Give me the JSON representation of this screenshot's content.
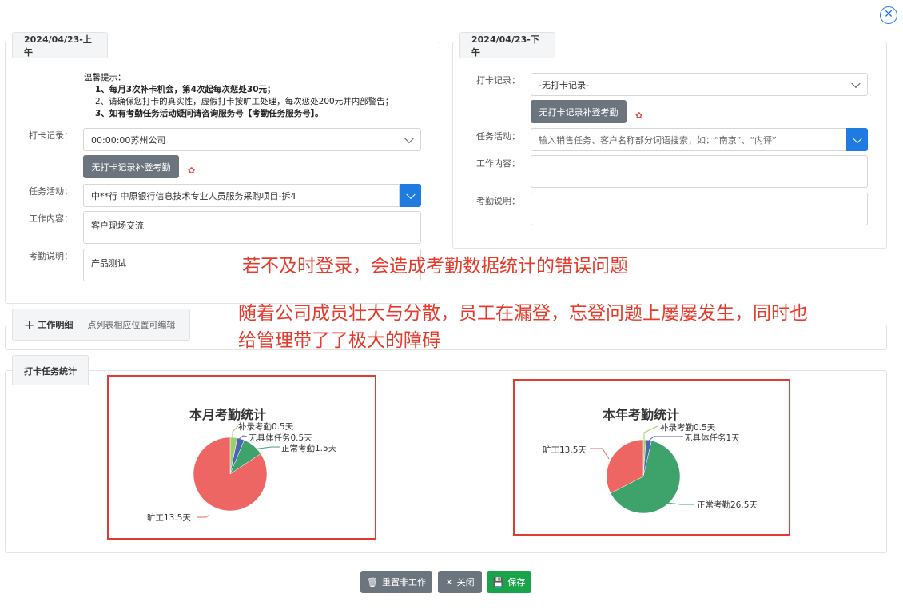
{
  "close_icon": "close-circle-icon",
  "morning": {
    "tab": "2024/04/23-上午",
    "notice": {
      "title": "温馨提示：",
      "line1": "1、每月3次补卡机会，第4次起每次惩处30元；",
      "line2": "2、请确保您打卡的真实性，虚假打卡按旷工处理，每次惩处200元并内部警告；",
      "line3": "3、如有考勤任务活动疑问请咨询服务号【考勤任务服务号】。"
    },
    "punch_label": "打卡记录：",
    "punch_value": "00:00:00苏州公司",
    "supplement_button": "无打卡记录补登考勤",
    "task_label": "任务活动：",
    "task_value": "中**行 中原银行信息技术专业人员服务采购项目-拆4",
    "work_label": "工作内容：",
    "work_value": "客户现场交流",
    "attendance_label": "考勤说明：",
    "attendance_value": "产品测试"
  },
  "afternoon": {
    "tab": "2024/04/23-下午",
    "punch_label": "打卡记录：",
    "punch_value": "-无打卡记录-",
    "supplement_button": "无打卡记录补登考勤",
    "task_label": "任务活动：",
    "task_placeholder": "输入销售任务、客户名称部分词语搜索，如：“南京”、“内评”",
    "work_label": "工作内容：",
    "attendance_label": "考勤说明："
  },
  "overlay_text": {
    "line1": "若不及时登录，会造成考勤数据统计的错误问题",
    "line2": "随着公司成员壮大与分散，员工在漏登，忘登问题上屡屡发生，同时也",
    "line3": "给管理带了了极大的障碍"
  },
  "work_detail": {
    "tab": "工作明细",
    "hint": "点列表相应位置可编辑"
  },
  "stats_tab": "打卡任务统计",
  "chart_data": [
    {
      "type": "pie",
      "title": "本月考勤统计",
      "series": [
        {
          "label": "补录考勤0.5天",
          "value": 0.5,
          "color": "#9bcf6d"
        },
        {
          "label": "无具体任务0.5天",
          "value": 0.5,
          "color": "#4f62b5"
        },
        {
          "label": "正常考勤1.5天",
          "value": 1.5,
          "color": "#3da36b"
        },
        {
          "label": "旷工13.5天",
          "value": 13.5,
          "color": "#ee6663"
        }
      ]
    },
    {
      "type": "pie",
      "title": "本年考勤统计",
      "series": [
        {
          "label": "补录考勤0.5天",
          "value": 0.5,
          "color": "#9bcf6d"
        },
        {
          "label": "无具体任务1天",
          "value": 1,
          "color": "#4f62b5"
        },
        {
          "label": "正常考勤26.5天",
          "value": 26.5,
          "color": "#3da36b"
        },
        {
          "label": "旷工13.5天",
          "value": 13.5,
          "color": "#ee6663"
        }
      ]
    }
  ],
  "footer": {
    "reset_label": "重置非工作",
    "close_label": "关闭",
    "save_label": "保存"
  }
}
